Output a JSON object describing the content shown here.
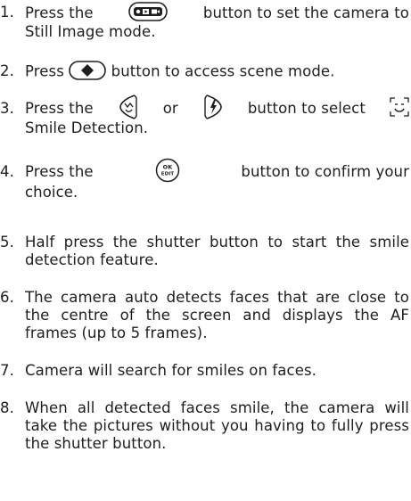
{
  "steps": [
    {
      "number": "1.",
      "text_before": "Press the",
      "icon": "mode-button-icon",
      "text_after": "button to set the camera to",
      "line2": "Still Image mode."
    },
    {
      "number": "2.",
      "text_before": "Press",
      "icon": "menu-button-icon",
      "text_after": "button to access scene mode."
    },
    {
      "number": "3.",
      "text_before": "Press the",
      "icon": "left-navigation-button-icon",
      "text_mid": "or",
      "icon2": "right-navigation-button-icon",
      "text_after": "button to select",
      "icon3": "smile-detection-icon",
      "line2": "Smile Detection."
    },
    {
      "number": "4.",
      "text_before": "Press the",
      "icon": "ok-edit-button-icon",
      "icon_label_top": "OK",
      "icon_label_bottom": "EDIT",
      "text_after": "button to confirm your",
      "line2": "choice."
    },
    {
      "number": "5.",
      "text": "Half press the shutter button to start the smile detection feature."
    },
    {
      "number": "6.",
      "text": "The camera auto detects faces that are close to the centre of the screen and displays the AF frames (up to 5 frames)."
    },
    {
      "number": "7.",
      "text": "Camera will search for smiles on faces."
    },
    {
      "number": "8.",
      "text": "When all detected faces smile, the camera will take the pictures without you having to fully press the shutter button."
    }
  ]
}
